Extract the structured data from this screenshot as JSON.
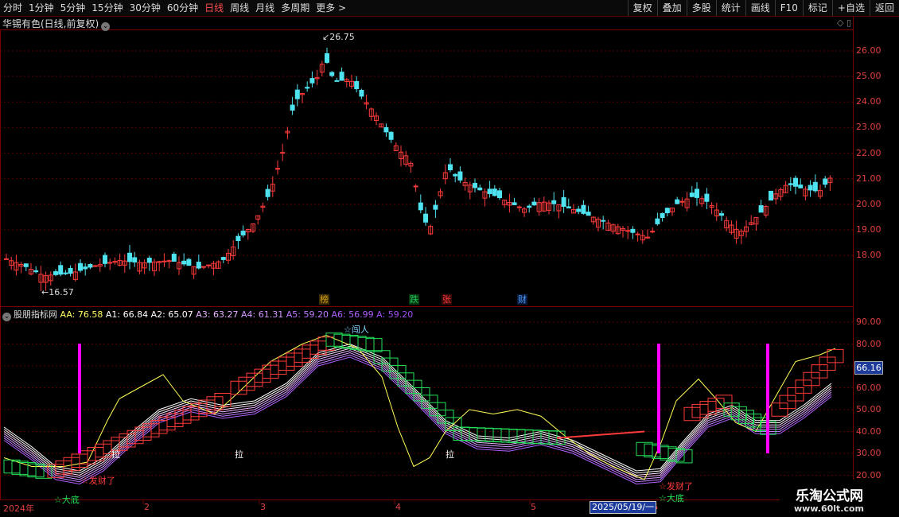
{
  "toolbar": {
    "periods": [
      "分时",
      "1分钟",
      "5分钟",
      "15分钟",
      "30分钟",
      "60分钟",
      "日线",
      "周线",
      "月线",
      "多周期",
      "更多 >"
    ],
    "active_period": "日线",
    "actions": [
      "复权",
      "叠加",
      "多股",
      "统计",
      "画线",
      "F10",
      "标记",
      "+自选",
      "返回"
    ]
  },
  "stock_title": "华锡有色(日线,前复权)",
  "price_axis": [
    "26.00",
    "25.00",
    "24.00",
    "23.00",
    "22.00",
    "21.00",
    "20.00",
    "19.00",
    "18.00"
  ],
  "price_high": "26.75",
  "price_low": "16.57",
  "event_markers": [
    {
      "label": "榜",
      "color": "#d4a017"
    },
    {
      "label": "跌",
      "color": "#22c55e"
    },
    {
      "label": "张",
      "color": "#ff3b3b"
    },
    {
      "label": "财",
      "color": "#2f80ed"
    }
  ],
  "indicator": {
    "name": "股朋指标网",
    "values": [
      {
        "label": "AA: 76.58",
        "color": "#ffff66"
      },
      {
        "label": "A1: 66.84",
        "color": "#ffffff"
      },
      {
        "label": "A2: 65.07",
        "color": "#ffffff"
      },
      {
        "label": "A3: 63.27",
        "color": "#e8b4ff"
      },
      {
        "label": "A4: 61.31",
        "color": "#d39cff"
      },
      {
        "label": "A5: 59.20",
        "color": "#c07cff"
      },
      {
        "label": "A6: 56.99",
        "color": "#b060ff"
      },
      {
        "label": "A: 59.20",
        "color": "#a050f0"
      }
    ],
    "axis": [
      "90.00",
      "80.00",
      "70.00",
      "60.00",
      "50.00",
      "40.00",
      "30.00",
      "20.00"
    ],
    "current_value": "66.16",
    "labels": {
      "la": "拉",
      "chuangren": "☆闯人",
      "fa_cai_1": "☆发财了",
      "fa_cai_2": "☆发财了",
      "da_di_1": "☆大底",
      "da_di_2": "☆大底"
    }
  },
  "x_axis": {
    "year": "2024年",
    "months": [
      "2",
      "3",
      "4",
      "5",
      "6"
    ],
    "cursor_date": "2025/05/19/一"
  },
  "watermark": {
    "title": "乐淘公式网",
    "url": "www.60lt.com"
  },
  "colors": {
    "up": "#ff3b3b",
    "down": "#4fe3f0",
    "signal": "#ff00ff",
    "grid": "#7a0000"
  }
}
